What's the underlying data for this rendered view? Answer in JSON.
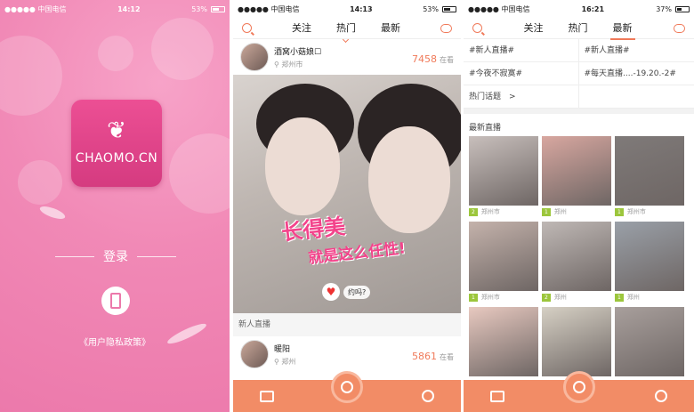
{
  "phone1": {
    "status": {
      "carrier": "●●●●● 中国电信",
      "time": "14:12",
      "battery": "53%"
    },
    "logo_text": "CHAOMO.CN",
    "login_label": "登录",
    "policy_link": "《用户隐私政策》"
  },
  "phone2": {
    "status": {
      "carrier": "●●●●● 中国电信",
      "time": "14:13",
      "battery": "53%"
    },
    "tabs": [
      "关注",
      "热门",
      "最新"
    ],
    "active_tab": "热门",
    "cards": [
      {
        "name": "酒窝小菇娘☐",
        "location": "郑州市",
        "count": "7458",
        "count_suffix": "在看"
      },
      {
        "name": "暖阳",
        "location": "郑州",
        "count": "5861",
        "count_suffix": "在看"
      }
    ],
    "photo_caption_1": "长得美",
    "photo_caption_2": "就是这么任性!",
    "heart_tag": "约吗?",
    "section_label": "新人直播"
  },
  "phone3": {
    "status": {
      "carrier": "●●●●● 中国电信",
      "time": "16:21",
      "battery": "37%"
    },
    "tabs": [
      "关注",
      "热门",
      "最新"
    ],
    "active_tab": "最新",
    "topics": [
      "#新人直播#",
      "#新人直播#",
      "#今夜不寂寞#",
      "#每天直播....-19.20.-2#",
      "热门话题　>",
      ""
    ],
    "latest_label": "最新直播",
    "grid": [
      {
        "badge": "2",
        "location": "郑州市"
      },
      {
        "badge": "1",
        "location": "郑州"
      },
      {
        "badge": "1",
        "location": "郑州市"
      },
      {
        "badge": "1",
        "location": "郑州市"
      },
      {
        "badge": "2",
        "location": "郑州"
      },
      {
        "badge": "1",
        "location": "郑州"
      },
      {
        "badge": "",
        "location": ""
      },
      {
        "badge": "",
        "location": ""
      },
      {
        "badge": "",
        "location": ""
      }
    ]
  },
  "colors": {
    "accent": "#f07a5a",
    "tabbar": "#f28c66",
    "login_bg": "#f189b6"
  }
}
